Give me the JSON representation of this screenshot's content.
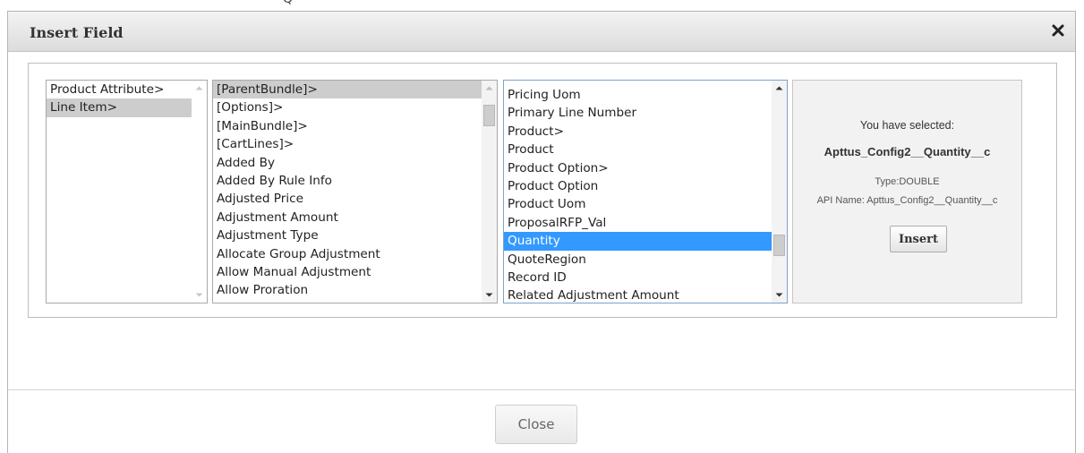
{
  "background_fragment": "Q",
  "dialog": {
    "title": "Insert Field",
    "close_icon": "close-x-icon"
  },
  "lists": {
    "objects": {
      "items": [
        "Product Attribute>",
        "Line Item>"
      ],
      "selected_index": 1
    },
    "related": {
      "items": [
        "[ParentBundle]>",
        "[Options]>",
        "[MainBundle]>",
        "[CartLines]>",
        "Added By",
        "Added By Rule Info",
        "Adjusted Price",
        "Adjustment Amount",
        "Adjustment Type",
        "Allocate Group Adjustment",
        "Allow Manual Adjustment",
        "Allow Proration"
      ],
      "selected_index": 0
    },
    "fields": {
      "items": [
        "Pricing Uom",
        "Primary Line Number",
        "Product>",
        "Product",
        "Product Option>",
        "Product Option",
        "Product Uom",
        "ProposalRFP_Val",
        "Quantity",
        "QuoteRegion",
        "Record ID",
        "Related Adjustment Amount"
      ],
      "selected_index": 8
    }
  },
  "selection_info": {
    "heading": "You have selected:",
    "field_name": "Apttus_Config2__Quantity__c",
    "type": "Type:DOUBLE",
    "api_name": "API Name: Apttus_Config2__Quantity__c",
    "insert_label": "Insert"
  },
  "footer": {
    "close_label": "Close"
  },
  "colors": {
    "selected_blue": "#3399ff",
    "selected_gray": "#cdcdcd"
  }
}
